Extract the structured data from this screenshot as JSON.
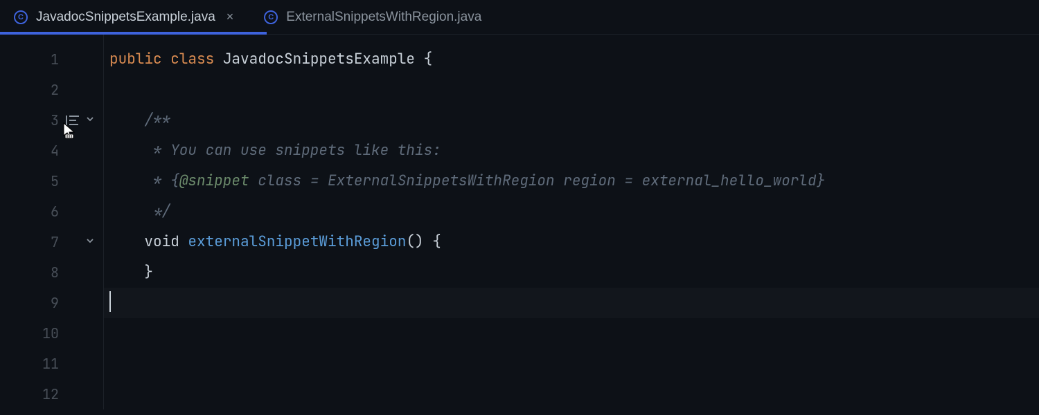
{
  "tabs": [
    {
      "label": "JavadocSnippetsExample.java",
      "active": true,
      "closable": true
    },
    {
      "label": "ExternalSnippetsWithRegion.java",
      "active": false,
      "closable": false
    }
  ],
  "icon_letter": "C",
  "close_glyph": "×",
  "lines": [
    {
      "num": "1",
      "fold": "",
      "doc": false,
      "tokens": [
        [
          "kw",
          "public"
        ],
        [
          "",
          null
        ],
        [
          "kw",
          "class"
        ],
        [
          "",
          null
        ],
        [
          "cls",
          "JavadocSnippetsExample"
        ],
        [
          "",
          null
        ],
        [
          "rt",
          "{"
        ]
      ]
    },
    {
      "num": "2",
      "fold": "",
      "doc": false,
      "tokens": []
    },
    {
      "num": "3",
      "fold": "v",
      "doc": true,
      "tokens": [
        [
          "",
          "    "
        ],
        [
          "doc",
          "/**"
        ]
      ]
    },
    {
      "num": "4",
      "fold": "",
      "doc": false,
      "tokens": [
        [
          "",
          "     "
        ],
        [
          "doc",
          "* You can use snippets like this:"
        ]
      ]
    },
    {
      "num": "5",
      "fold": "",
      "doc": false,
      "tokens": [
        [
          "",
          "     "
        ],
        [
          "doc",
          "* {"
        ],
        [
          "doctag",
          "@snippet"
        ],
        [
          "doc",
          " class = ExternalSnippetsWithRegion region = external_hello_world}"
        ]
      ]
    },
    {
      "num": "6",
      "fold": "",
      "doc": false,
      "tokens": [
        [
          "",
          "     "
        ],
        [
          "doc",
          "*/"
        ]
      ]
    },
    {
      "num": "7",
      "fold": "v",
      "doc": false,
      "tokens": [
        [
          "",
          "    "
        ],
        [
          "rt",
          "void"
        ],
        [
          "",
          null
        ],
        [
          "fn",
          "externalSnippetWithRegion"
        ],
        [
          "rt",
          "()"
        ],
        [
          "",
          null
        ],
        [
          "rt",
          "{"
        ]
      ]
    },
    {
      "num": "8",
      "fold": "",
      "doc": false,
      "tokens": [
        [
          "",
          "    "
        ],
        [
          "rt",
          "}"
        ]
      ]
    },
    {
      "num": "9",
      "fold": "",
      "doc": false,
      "tokens": [],
      "cursor": true
    },
    {
      "num": "10",
      "fold": "",
      "doc": false,
      "tokens": []
    },
    {
      "num": "11",
      "fold": "",
      "doc": false,
      "tokens": []
    },
    {
      "num": "12",
      "fold": "",
      "doc": false,
      "tokens": []
    }
  ]
}
